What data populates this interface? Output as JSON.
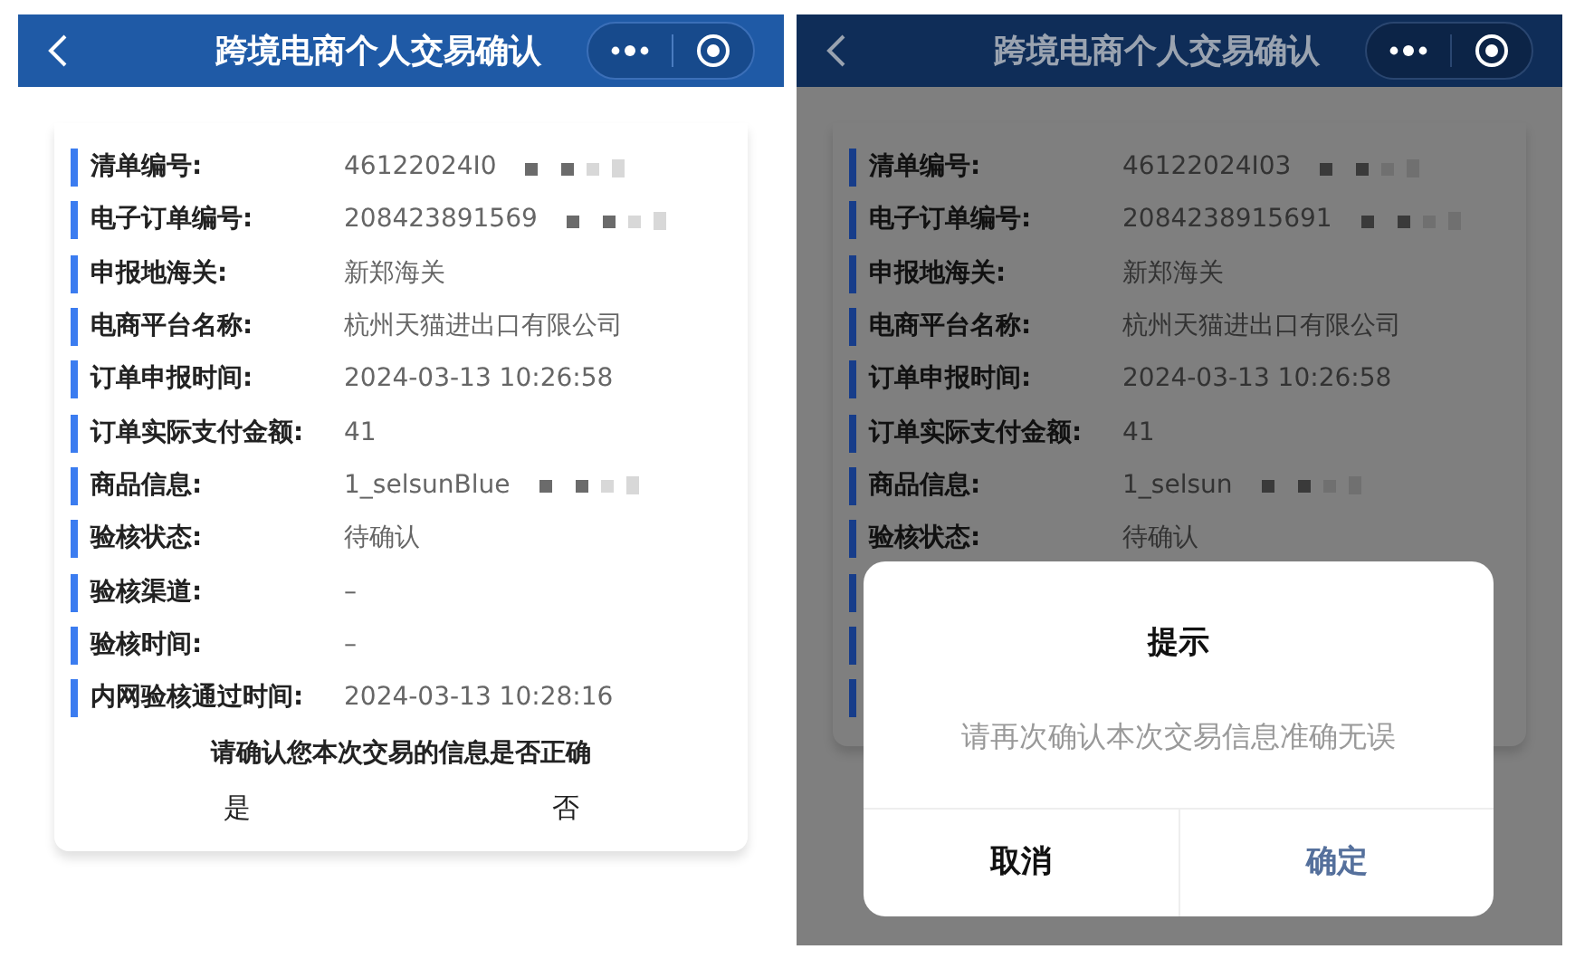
{
  "screens": [
    {
      "dimmed": false,
      "title": "跨境电商个人交易确认",
      "rows": [
        {
          "kind": "field",
          "label": "清单编号:",
          "value": "46122024I0",
          "redacted": true
        },
        {
          "kind": "field",
          "label": "电子订单编号:",
          "value": "208423891569",
          "redacted": true
        },
        {
          "kind": "field",
          "label": "申报地海关:",
          "value": "新郑海关",
          "redacted": false
        },
        {
          "kind": "field",
          "label": "电商平台名称:",
          "value": "杭州天猫进出口有限公司",
          "redacted": false
        },
        {
          "kind": "field",
          "label": "订单申报时间:",
          "value": "2024-03-13 10:26:58",
          "redacted": false
        },
        {
          "kind": "field",
          "label": "订单实际支付金额:",
          "value": "41",
          "redacted": false
        },
        {
          "kind": "field",
          "label": "商品信息:",
          "value": "1_selsunBlue",
          "redacted": true
        },
        {
          "kind": "field",
          "label": "验核状态:",
          "value": "待确认",
          "redacted": false
        },
        {
          "kind": "field",
          "label": "验核渠道:",
          "value": "–",
          "redacted": false
        },
        {
          "kind": "field",
          "label": "验核时间:",
          "value": "–",
          "redacted": false
        },
        {
          "kind": "field",
          "label": "内网验核通过时间:",
          "value": "2024-03-13 10:28:16",
          "redacted": false
        }
      ],
      "prompt": {
        "question": "请确认您本次交易的信息是否正确",
        "yes": "是",
        "no": "否"
      }
    },
    {
      "dimmed": true,
      "title": "跨境电商个人交易确认",
      "rows": [
        {
          "kind": "field",
          "label": "清单编号:",
          "value": "46122024I03",
          "redacted": true
        },
        {
          "kind": "field",
          "label": "电子订单编号:",
          "value": "2084238915691",
          "redacted": true
        },
        {
          "kind": "field",
          "label": "申报地海关:",
          "value": "新郑海关",
          "redacted": false
        },
        {
          "kind": "field",
          "label": "电商平台名称:",
          "value": "杭州天猫进出口有限公司",
          "redacted": false
        },
        {
          "kind": "field",
          "label": "订单申报时间:",
          "value": "2024-03-13 10:26:58",
          "redacted": false
        },
        {
          "kind": "field",
          "label": "订单实际支付金额:",
          "value": "41",
          "redacted": false
        },
        {
          "kind": "field",
          "label": "商品信息:",
          "value": "1_selsun",
          "redacted": true
        },
        {
          "kind": "field",
          "label": "验核状态:",
          "value": "待确认",
          "redacted": false
        },
        {
          "kind": "covered"
        },
        {
          "kind": "covered"
        },
        {
          "kind": "covered"
        }
      ],
      "dialog": {
        "title": "提示",
        "message": "请再次确认本次交易信息准确无误",
        "cancel": "取消",
        "confirm": "确定"
      }
    }
  ]
}
